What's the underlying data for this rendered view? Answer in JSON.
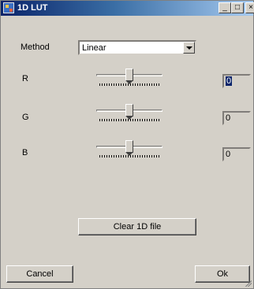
{
  "window": {
    "title": "1D LUT",
    "minimize_glyph": "_",
    "maximize_glyph": "□",
    "close_glyph": "×"
  },
  "method": {
    "label": "Method",
    "selected": "Linear"
  },
  "channels": [
    {
      "label": "R",
      "value": "0",
      "slider_fraction": 0.5
    },
    {
      "label": "G",
      "value": "0",
      "slider_fraction": 0.5
    },
    {
      "label": "B",
      "value": "0",
      "slider_fraction": 0.5
    }
  ],
  "buttons": {
    "clear": "Clear 1D file",
    "cancel": "Cancel",
    "ok": "Ok"
  }
}
